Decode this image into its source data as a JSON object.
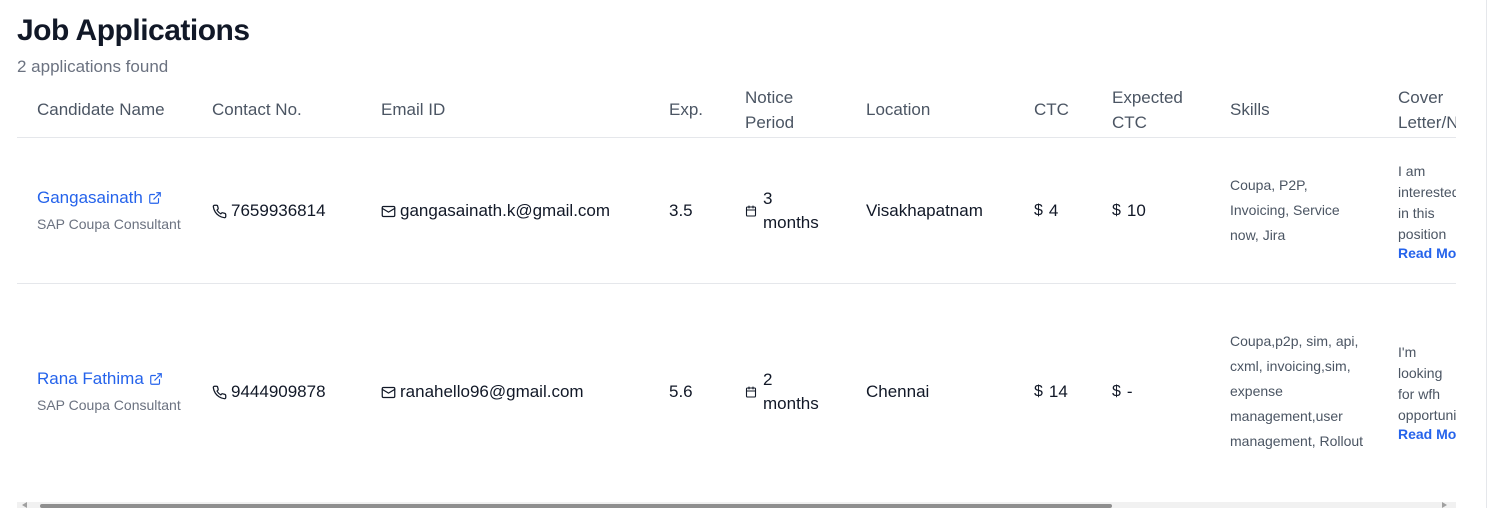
{
  "page": {
    "title": "Job Applications",
    "subtitle": "2 applications found"
  },
  "table": {
    "headers": {
      "name": "Candidate Name",
      "contact": "Contact No.",
      "email": "Email ID",
      "exp": "Exp.",
      "notice": "Notice Period",
      "location": "Location",
      "ctc": "CTC",
      "expected_ctc": "Expected CTC",
      "skills": "Skills",
      "cover": "Cover Letter/Note"
    },
    "rows": [
      {
        "name": "Gangasainath",
        "role": "SAP Coupa Consultant",
        "contact": "7659936814",
        "email": "gangasainath.k@gmail.com",
        "exp": "3.5",
        "notice": "3 months",
        "location": "Visakhapatnam",
        "ctc": "4",
        "expected_ctc": "10",
        "skills": "Coupa, P2P, Invoicing, Service now, Jira",
        "cover": "I am interested in this position and my skills are...",
        "read_more": "Read More"
      },
      {
        "name": "Rana Fathima",
        "role": "SAP Coupa Consultant",
        "contact": "9444909878",
        "email": "ranahello96@gmail.com",
        "exp": "5.6",
        "notice": "2 months",
        "location": "Chennai",
        "ctc": "14",
        "expected_ctc": "-",
        "skills": "Coupa,p2p, sim, api, cxml, invoicing,sim, expense management,user management, Rollout",
        "cover": "I'm looking for wfh opportunity and it ll fit and...",
        "read_more": "Read More"
      }
    ],
    "currency_symbol": "$"
  },
  "icons": {
    "external_link": "external-link-icon",
    "phone": "phone-icon",
    "mail": "mail-icon",
    "calendar": "calendar-icon"
  },
  "colors": {
    "link": "#2563eb",
    "muted": "#6b7280",
    "border": "#e5e7eb"
  }
}
